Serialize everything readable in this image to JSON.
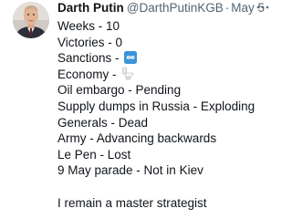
{
  "tweet": {
    "author": {
      "display_name": "Darth Putin",
      "handle": "@DarthPutinKGB",
      "avatar_icon": "portrait-avatar"
    },
    "separator": "·",
    "date": "May 5",
    "more_icon": "ellipsis-icon",
    "lines": [
      "Weeks - 10",
      "Victories - 0",
      "Sanctions -",
      "Economy -",
      "Oil embargo - Pending",
      "Supply dumps in Russia - Exploding",
      "Generals - Dead",
      "Army - Advancing backwards",
      "Le Pen - Lost",
      "9 May parade - Not in Kiev"
    ],
    "closing_line": "I remain a master strategist",
    "emoji": {
      "infinity": "infinity-icon",
      "toilet": "toilet-icon"
    },
    "colors": {
      "text": "#0f1419",
      "secondary": "#536471",
      "infinity_badge": "#3b94d9"
    }
  }
}
